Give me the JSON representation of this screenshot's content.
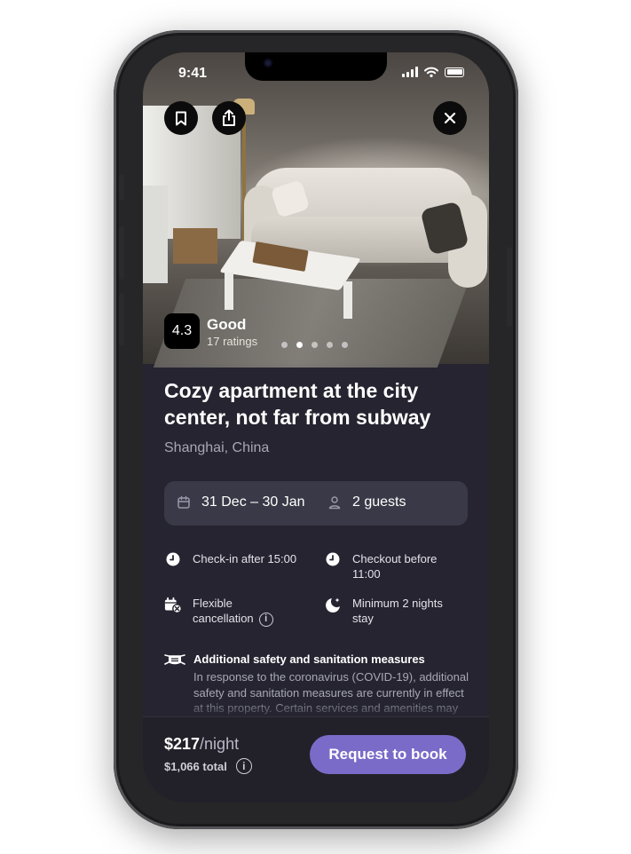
{
  "status_bar": {
    "time": "9:41"
  },
  "hero": {
    "rating_score": "4.3",
    "rating_label": "Good",
    "rating_count": "17 ratings",
    "carousel": {
      "total": 5,
      "active_index": 1
    }
  },
  "listing": {
    "title": "Cozy apartment at the city center, not far from subway",
    "location": "Shanghai, China"
  },
  "booking": {
    "dates": "31 Dec – 30 Jan",
    "guests": "2 guests"
  },
  "features": {
    "checkin": "Check-in after 15:00",
    "checkout_line1": "Checkout before",
    "checkout_line2": "11:00",
    "cancel_line1": "Flexible",
    "cancel_line2": "cancellation",
    "minstay_line1": "Minimum 2 nights",
    "minstay_line2": "stay"
  },
  "safety": {
    "title": "Additional safety and sanitation measures",
    "text": "In response to the coronavirus (COVID-19), additional safety and sanitation measures are currently in effect at this property. Certain services and amenities may be reduced or unavailable."
  },
  "footer": {
    "price": "$217",
    "per": "/night",
    "total": "$1,066 total",
    "book_label": "Request to book"
  },
  "info_glyph": "i",
  "colors": {
    "accent": "#7b6bc8",
    "background": "#252430",
    "card": "#3a3947"
  }
}
